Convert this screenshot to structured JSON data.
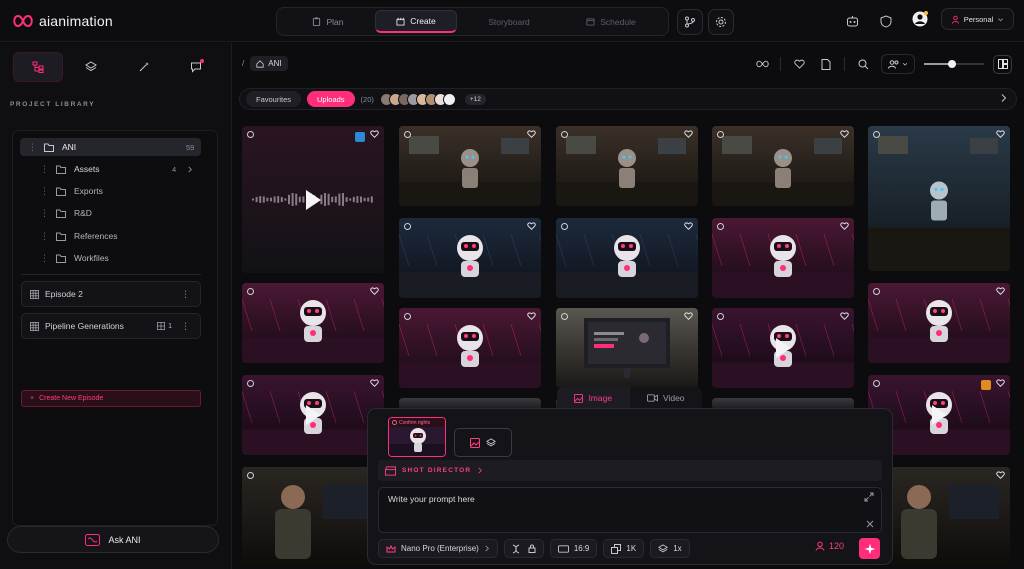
{
  "app": {
    "name": "aianimation",
    "brand_color": "#ff2d7a"
  },
  "nav": {
    "tabs": [
      {
        "label": "Plan",
        "icon": "clipboard-icon",
        "state": "normal"
      },
      {
        "label": "Create",
        "icon": "clapper-icon",
        "state": "active"
      },
      {
        "label": "Storyboard",
        "icon": "",
        "state": "muted"
      },
      {
        "label": "Schedule",
        "icon": "calendar-icon",
        "state": "muted"
      }
    ]
  },
  "header": {
    "account_label": "Personal"
  },
  "sidebar": {
    "section_title": "PROJECT LIBRARY",
    "tree": {
      "root": {
        "label": "ANI",
        "count": "59"
      },
      "children": [
        {
          "label": "Assets",
          "count": "4"
        },
        {
          "label": "Exports"
        },
        {
          "label": "R&D"
        },
        {
          "label": "References"
        },
        {
          "label": "Workfiles"
        }
      ]
    },
    "episodes": [
      {
        "label": "Episode 2"
      },
      {
        "label": "Pipeline Generations",
        "count": "1"
      }
    ],
    "new_episode_label": "Create New Episode",
    "ask_label": "Ask ANI"
  },
  "main": {
    "breadcrumb_sep": "/",
    "breadcrumb_item": "ANI",
    "filters": {
      "favourites": "Favourites",
      "uploads": "Uploads",
      "count": "(20)",
      "more": "+12"
    },
    "zoom_level": 0.46,
    "media_toggle": {
      "image": "Image",
      "video": "Video",
      "selected": "Image"
    }
  },
  "composer": {
    "ref_label": "Confirm rights",
    "shot_director": "SHOT DIRECTOR",
    "prompt_placeholder": "Write your prompt here",
    "model": "Nano Pro (Enterprise)",
    "aspect": "16:9",
    "resolution": "1K",
    "multiplier": "1x",
    "credits": "120"
  }
}
